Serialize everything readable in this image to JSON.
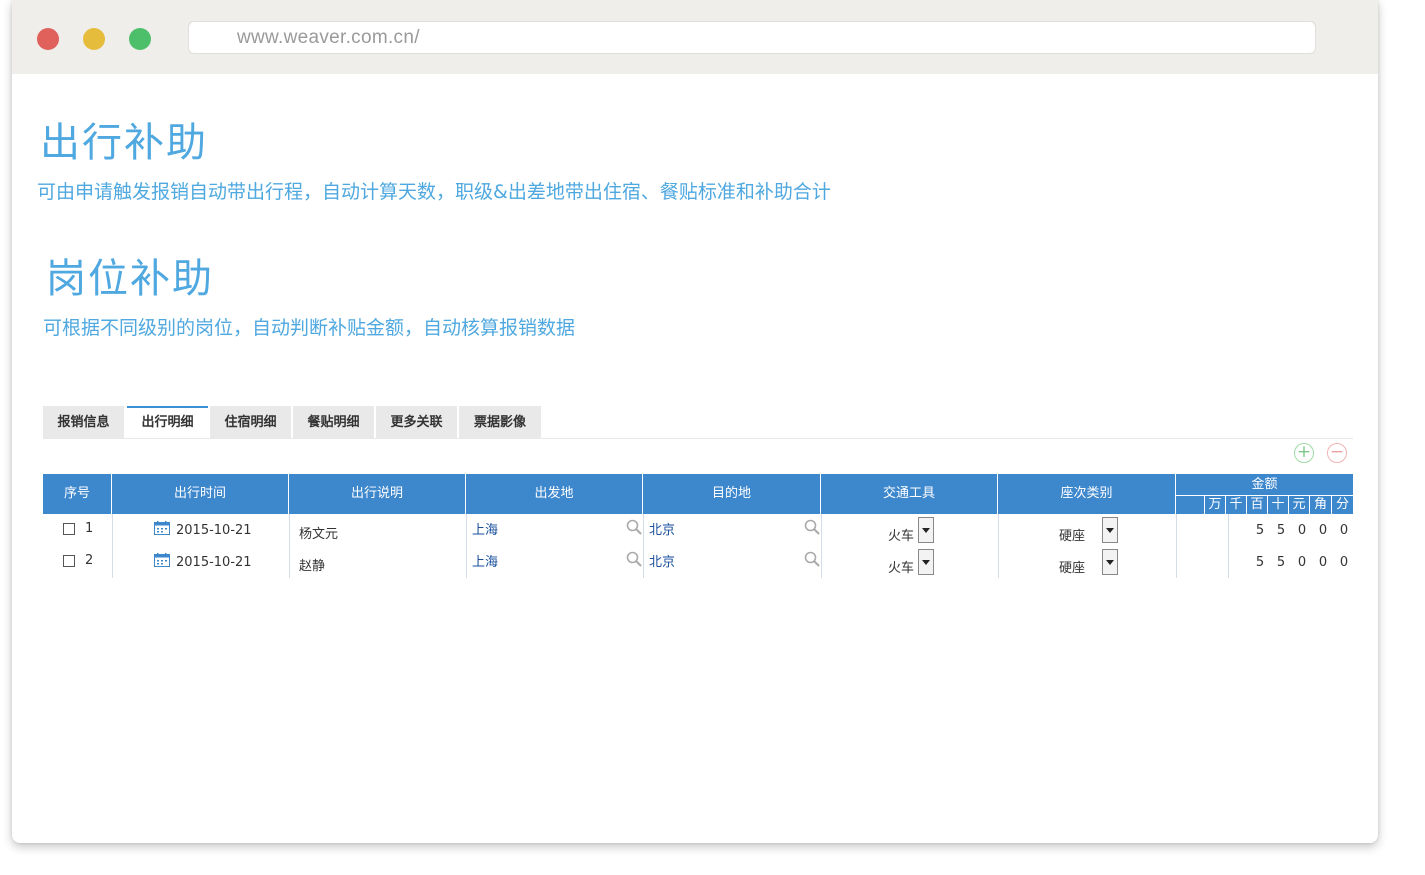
{
  "browser": {
    "url": "www.weaver.com.cn/"
  },
  "sections": [
    {
      "title": "出行补助",
      "desc": "可由申请触发报销自动带出行程，自动计算天数，职级&出差地带出住宿、餐贴标准和补助合计"
    },
    {
      "title": "岗位补助",
      "desc": "可根据不同级别的岗位，自动判断补贴金额，自动核算报销数据"
    }
  ],
  "tabs": [
    "报销信息",
    "出行明细",
    "住宿明细",
    "餐贴明细",
    "更多关联",
    "票据影像"
  ],
  "active_tab": "出行明细",
  "table": {
    "headers": [
      "序号",
      "出行时间",
      "出行说明",
      "出发地",
      "目的地",
      "交通工具",
      "座次类别"
    ],
    "amount_header": "金额",
    "amount_units": [
      "万",
      "千",
      "百",
      "十",
      "元",
      "角",
      "分"
    ],
    "rows": [
      {
        "no": "1",
        "date": "2015-10-21",
        "person": "杨文元",
        "from": "上海",
        "to": "北京",
        "transport": "火车",
        "seat": "硬座",
        "digits": [
          "",
          "",
          "5",
          "5",
          "0",
          "0",
          "0"
        ]
      },
      {
        "no": "2",
        "date": "2015-10-21",
        "person": "赵静",
        "from": "上海",
        "to": "北京",
        "transport": "火车",
        "seat": "硬座",
        "digits": [
          "",
          "",
          "5",
          "5",
          "0",
          "0",
          "0"
        ]
      }
    ]
  },
  "buttons": {
    "add": "+",
    "remove": "−"
  },
  "colors": {
    "accent_text": "#4fa8e0",
    "table_header": "#3d87cd",
    "tab_active_border": "#3a8fd6"
  }
}
